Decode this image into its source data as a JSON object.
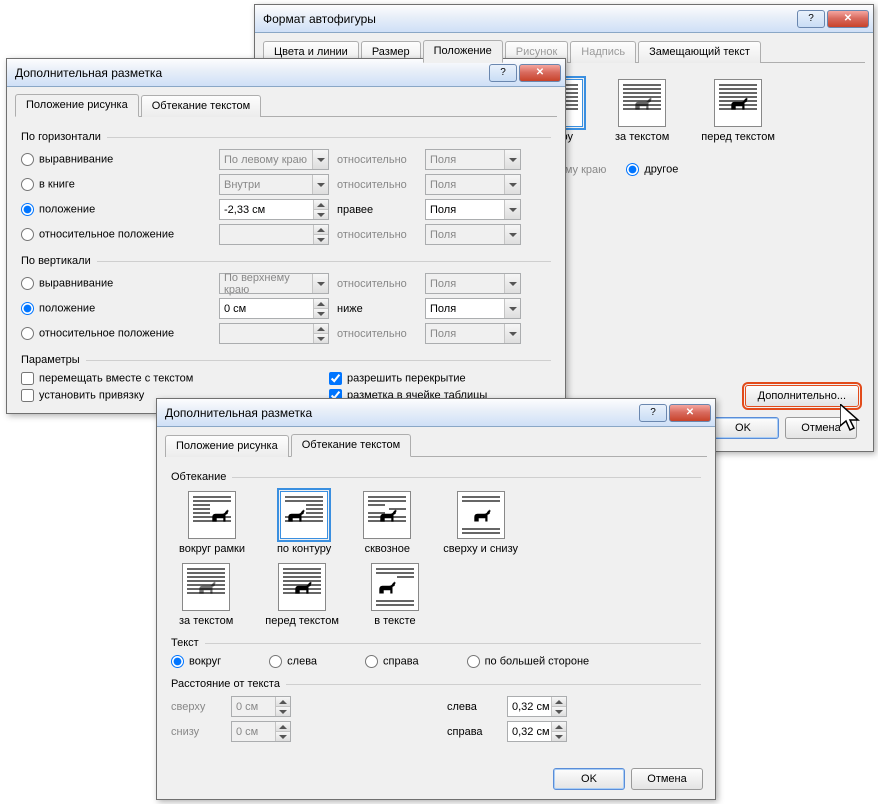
{
  "dlg_format": {
    "title": "Формат автофигуры",
    "tabs": {
      "colors": "Цвета и линии",
      "size": "Размер",
      "position": "Положение",
      "picture": "Рисунок",
      "textbox": "Надпись",
      "alttext": "Замещающий текст"
    },
    "wrap_by_contour": "нтуру",
    "wrap_behind": "за текстом",
    "wrap_infront": "перед текстом",
    "radio_left_edge_partial": "вому краю",
    "radio_other": "другое",
    "btn_more": "Дополнительно...",
    "btn_ok": "OK",
    "btn_cancel": "Отмена"
  },
  "dlg_layout_pos": {
    "title": "Дополнительная разметка",
    "tab_position": "Положение рисунка",
    "tab_wrap": "Обтекание текстом",
    "grp_h": "По горизонтали",
    "grp_v": "По вертикали",
    "grp_params": "Параметры",
    "opt_align": "выравнивание",
    "opt_book": "в книге",
    "opt_pos": "положение",
    "opt_relpos": "относительное положение",
    "cmb_left": "По левому краю",
    "cmb_inside": "Внутри",
    "cmb_top": "По верхнему краю",
    "lbl_relative": "относительно",
    "lbl_rightof": "правее",
    "lbl_below": "ниже",
    "cmb_fields": "Поля",
    "val_h_pos": "-2,33 см",
    "val_v_pos": "0 см",
    "chk_move": "перемещать вместе с текстом",
    "chk_anchor": "установить привязку",
    "chk_overlap": "разрешить перекрытие",
    "chk_celllayout": "разметка в ячейке таблицы"
  },
  "dlg_layout_wrap": {
    "title": "Дополнительная разметка",
    "tab_position": "Положение рисунка",
    "tab_wrap": "Обтекание текстом",
    "grp_wrap": "Обтекание",
    "grp_text": "Текст",
    "grp_dist": "Расстояние от текста",
    "w_square": "вокруг рамки",
    "w_tight": "по контуру",
    "w_through": "сквозное",
    "w_topbottom": "сверху и снизу",
    "w_behind": "за текстом",
    "w_infront": "перед текстом",
    "w_inline": "в тексте",
    "t_around": "вокруг",
    "t_left": "слева",
    "t_right": "справа",
    "t_largest": "по большей стороне",
    "d_top": "сверху",
    "d_bottom": "снизу",
    "d_left": "слева",
    "d_right": "справа",
    "d_top_v": "0 см",
    "d_bottom_v": "0 см",
    "d_left_v": "0,32 см",
    "d_right_v": "0,32 см",
    "btn_ok": "OK",
    "btn_cancel": "Отмена"
  }
}
